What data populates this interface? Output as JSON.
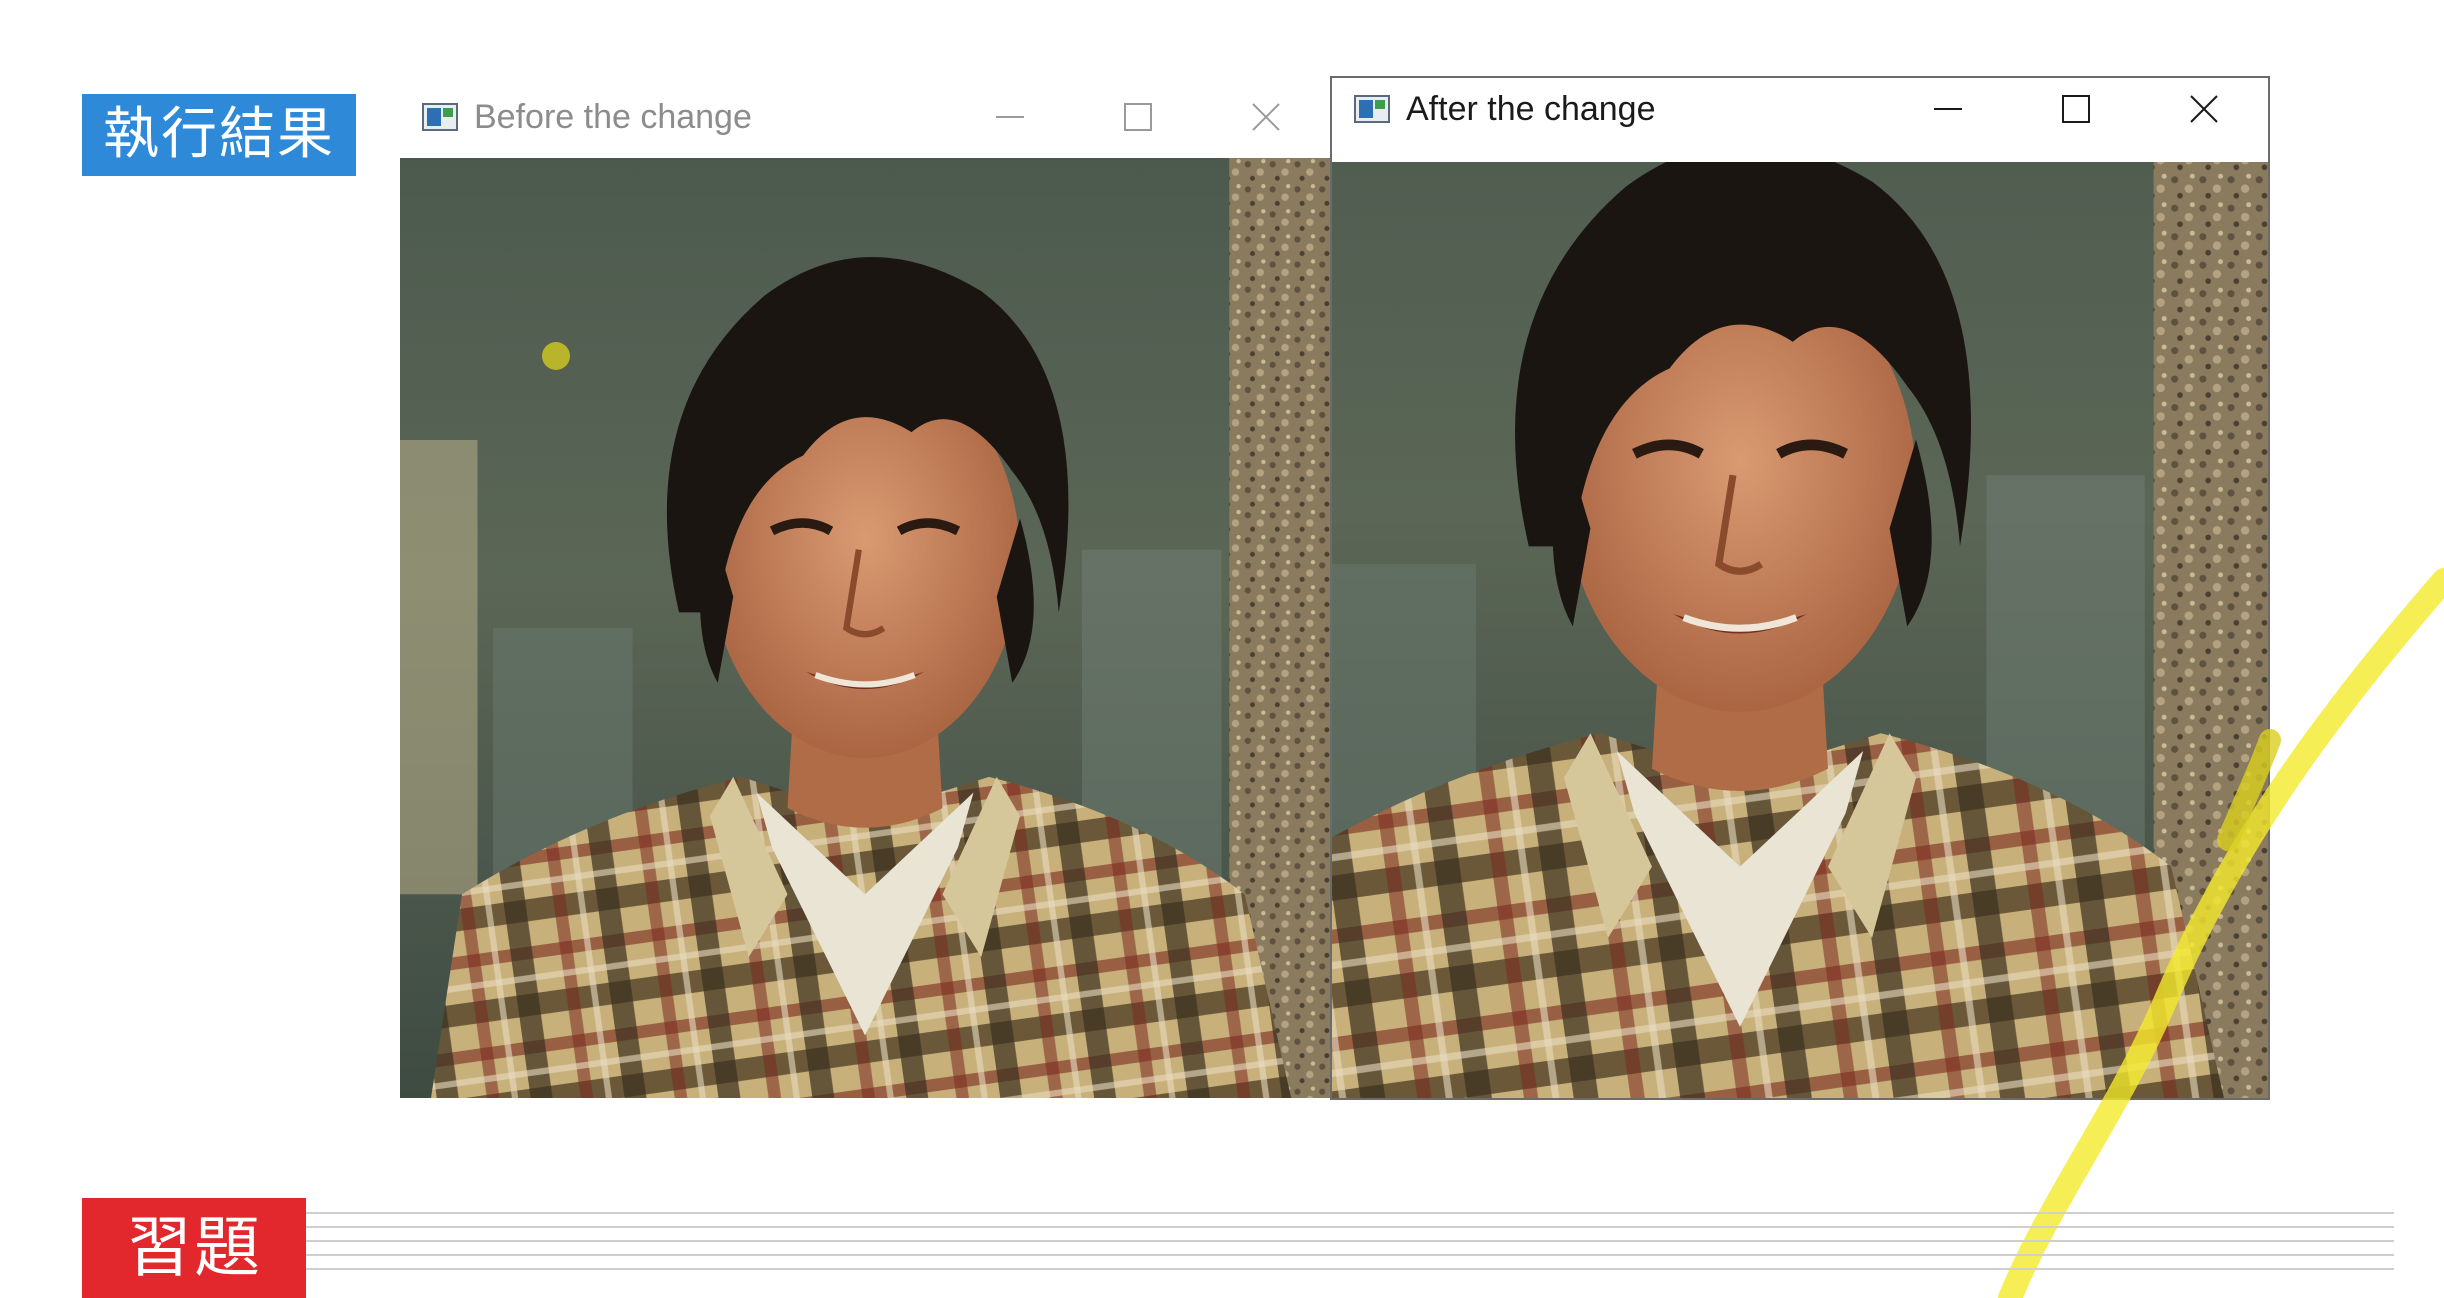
{
  "slide": {
    "section_label": "執行結果",
    "exercise_label": "習題"
  },
  "windows": [
    {
      "id": "before",
      "title": "Before the change",
      "state": "inactive"
    },
    {
      "id": "after",
      "title": "After the change",
      "state": "active"
    }
  ],
  "colors": {
    "section_tag": "#2e8ad8",
    "exercise_tag": "#e2282c",
    "highlighter": "#f4ea2a",
    "pen_dot": "#b9b52a"
  },
  "icons": {
    "window_app": "opencv-window-icon",
    "minimize": "minimize-icon",
    "maximize": "maximize-icon",
    "close": "close-icon"
  }
}
